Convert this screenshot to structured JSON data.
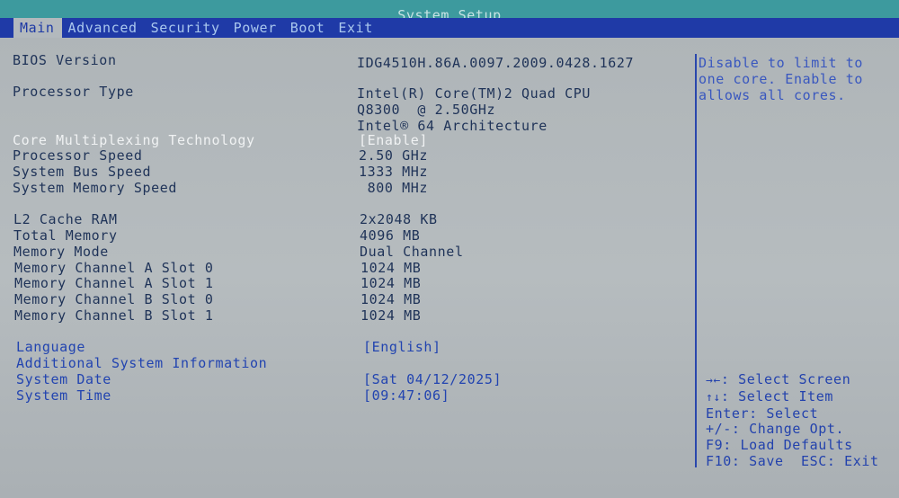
{
  "window": {
    "title": "System Setup"
  },
  "menu": {
    "tabs": [
      {
        "label": "Main",
        "active": true
      },
      {
        "label": "Advanced",
        "active": false
      },
      {
        "label": "Security",
        "active": false
      },
      {
        "label": "Power",
        "active": false
      },
      {
        "label": "Boot",
        "active": false
      },
      {
        "label": "Exit",
        "active": false
      }
    ]
  },
  "info": {
    "bios_version": {
      "label": "BIOS Version",
      "value": "IDG4510H.86A.0097.2009.0428.1627"
    },
    "processor_type": {
      "label": "Processor Type",
      "value_lines": [
        "Intel(R) Core(TM)2 Quad CPU",
        "Q8300  @ 2.50GHz",
        "Intel® 64 Architecture"
      ]
    },
    "core_multiplexing": {
      "label": "Core Multiplexing Technology",
      "value": "[Enable]"
    },
    "processor_speed": {
      "label": "Processor Speed",
      "value": "2.50 GHz"
    },
    "system_bus_speed": {
      "label": "System Bus Speed",
      "value": "1333 MHz"
    },
    "system_memory_speed": {
      "label": "System Memory Speed",
      "value": " 800 MHz"
    },
    "l2_cache": {
      "label": "L2 Cache RAM",
      "value": "2x2048 KB"
    },
    "total_memory": {
      "label": "Total Memory",
      "value": "4096 MB"
    },
    "memory_mode": {
      "label": "Memory Mode",
      "value": "Dual Channel"
    },
    "channel_a_slot0": {
      "label": "Memory Channel A Slot 0",
      "value": "1024 MB"
    },
    "channel_a_slot1": {
      "label": "Memory Channel A Slot 1",
      "value": "1024 MB"
    },
    "channel_b_slot0": {
      "label": "Memory Channel B Slot 0",
      "value": "1024 MB"
    },
    "channel_b_slot1": {
      "label": "Memory Channel B Slot 1",
      "value": "1024 MB"
    }
  },
  "settings": {
    "language": {
      "label": "Language",
      "value": "[English]"
    },
    "additional_info": {
      "label": "Additional System Information"
    },
    "system_date": {
      "label": "System Date",
      "value": "[Sat 04/12/2025]"
    },
    "system_time": {
      "label": "System Time",
      "value": "[09:47:06]"
    }
  },
  "help": {
    "lines": [
      "Disable to limit to",
      "one core. Enable to",
      "allows all cores."
    ]
  },
  "keys": [
    {
      "key": "→←",
      "action": ": Select Screen"
    },
    {
      "key": "↑↓",
      "action": ": Select Item"
    },
    {
      "key": "Enter",
      "action": ": Select"
    },
    {
      "key": "+/-",
      "action": ": Change Opt."
    },
    {
      "key": "F9",
      "action": ": Load Defaults"
    },
    {
      "key": "F10",
      "action": ": Save  ESC: Exit"
    }
  ],
  "colors": {
    "background": "#b3b9bd",
    "title_bar": "#3d9a9e",
    "menu_bar": "#1f3aa7",
    "text": "#1f3358",
    "highlight": "#f0f2f3",
    "selectable": "#2244b0"
  }
}
